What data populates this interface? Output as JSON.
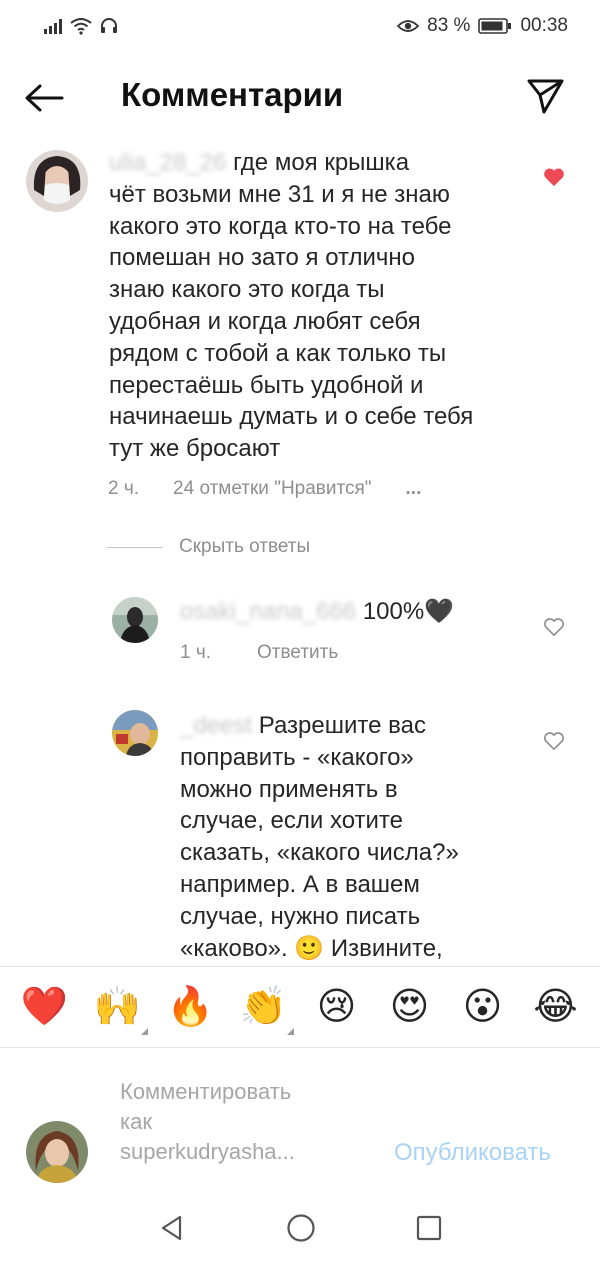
{
  "status_bar": {
    "battery_percent": "83 %",
    "time": "00:38"
  },
  "header": {
    "title": "Комментарии"
  },
  "comments": {
    "main": {
      "username": "ulia_28_26",
      "lines": [
        "где моя крышка",
        "чёт возьми мне 31 и я не знаю",
        "какого это когда кто-то на тебе",
        "помешан но зато я отлично",
        "знаю какого это когда ты",
        "удобная и когда любят себя",
        "рядом с тобой а как только ты",
        "перестаёшь быть удобной и",
        "начинаешь думать и о себе тебя",
        "тут же бросают"
      ],
      "time": "2 ч.",
      "likes": "24 отметки \"Нравится\"",
      "more": "...",
      "liked": true
    },
    "hide_replies": "Скрыть ответы",
    "reply1": {
      "username": "osaki_nana_666",
      "text": "100%🖤",
      "time": "1 ч.",
      "reply_label": "Ответить"
    },
    "reply2": {
      "username": "_deest",
      "lines": [
        "Разрешите вас",
        "поправить - «какого»",
        "можно применять в",
        "случае, если хотите",
        "сказать, «какого числа?»",
        "например. А в вашем",
        "случае, нужно писать",
        "«каково». 🙂 Извините,"
      ]
    }
  },
  "emoji_bar": [
    "❤️",
    "🙌",
    "🔥",
    "👏",
    "😢",
    "😍",
    "😮",
    "😂"
  ],
  "input": {
    "placeholder_lines": [
      "Комментировать",
      "как",
      "superkudryasha..."
    ],
    "publish_label": "Опубликовать"
  },
  "colors": {
    "heart_red": "#ed4956",
    "publish_blue": "#a9d2f5",
    "meta_gray": "#8e8e8e"
  }
}
